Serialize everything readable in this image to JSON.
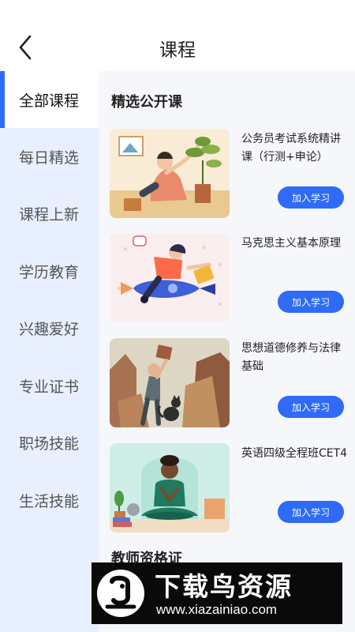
{
  "header": {
    "title": "课程"
  },
  "sidebar": {
    "items": [
      {
        "label": "全部课程",
        "active": true
      },
      {
        "label": "每日精选",
        "active": false
      },
      {
        "label": "课程上新",
        "active": false
      },
      {
        "label": "学历教育",
        "active": false
      },
      {
        "label": "兴趣爱好",
        "active": false
      },
      {
        "label": "专业证书",
        "active": false
      },
      {
        "label": "职场技能",
        "active": false
      },
      {
        "label": "生活技能",
        "active": false
      }
    ]
  },
  "main": {
    "section_title": "精选公开课",
    "next_section_title": "教师资格证",
    "courses": [
      {
        "title": "公务员考试系统精讲课（行测+申论）",
        "button": "加入学习",
        "thumb": "yoga-woman-plant-illustration"
      },
      {
        "title": "马克思主义基本原理",
        "button": "加入学习",
        "thumb": "woman-riding-rocket-illustration"
      },
      {
        "title": "思想道德修养与法律基础",
        "button": "加入学习",
        "thumb": "woman-with-cat-boxes-illustration"
      },
      {
        "title": "英语四级全程班CET4",
        "button": "加入学习",
        "thumb": "meditating-woman-illustration"
      }
    ]
  },
  "watermark": {
    "text": "下载鸟资源",
    "url": "www.xiazainiao.com"
  },
  "colors": {
    "accent": "#2f6bf6",
    "sidebar_bg": "#e8efff",
    "main_bg": "#f5f7fb"
  }
}
